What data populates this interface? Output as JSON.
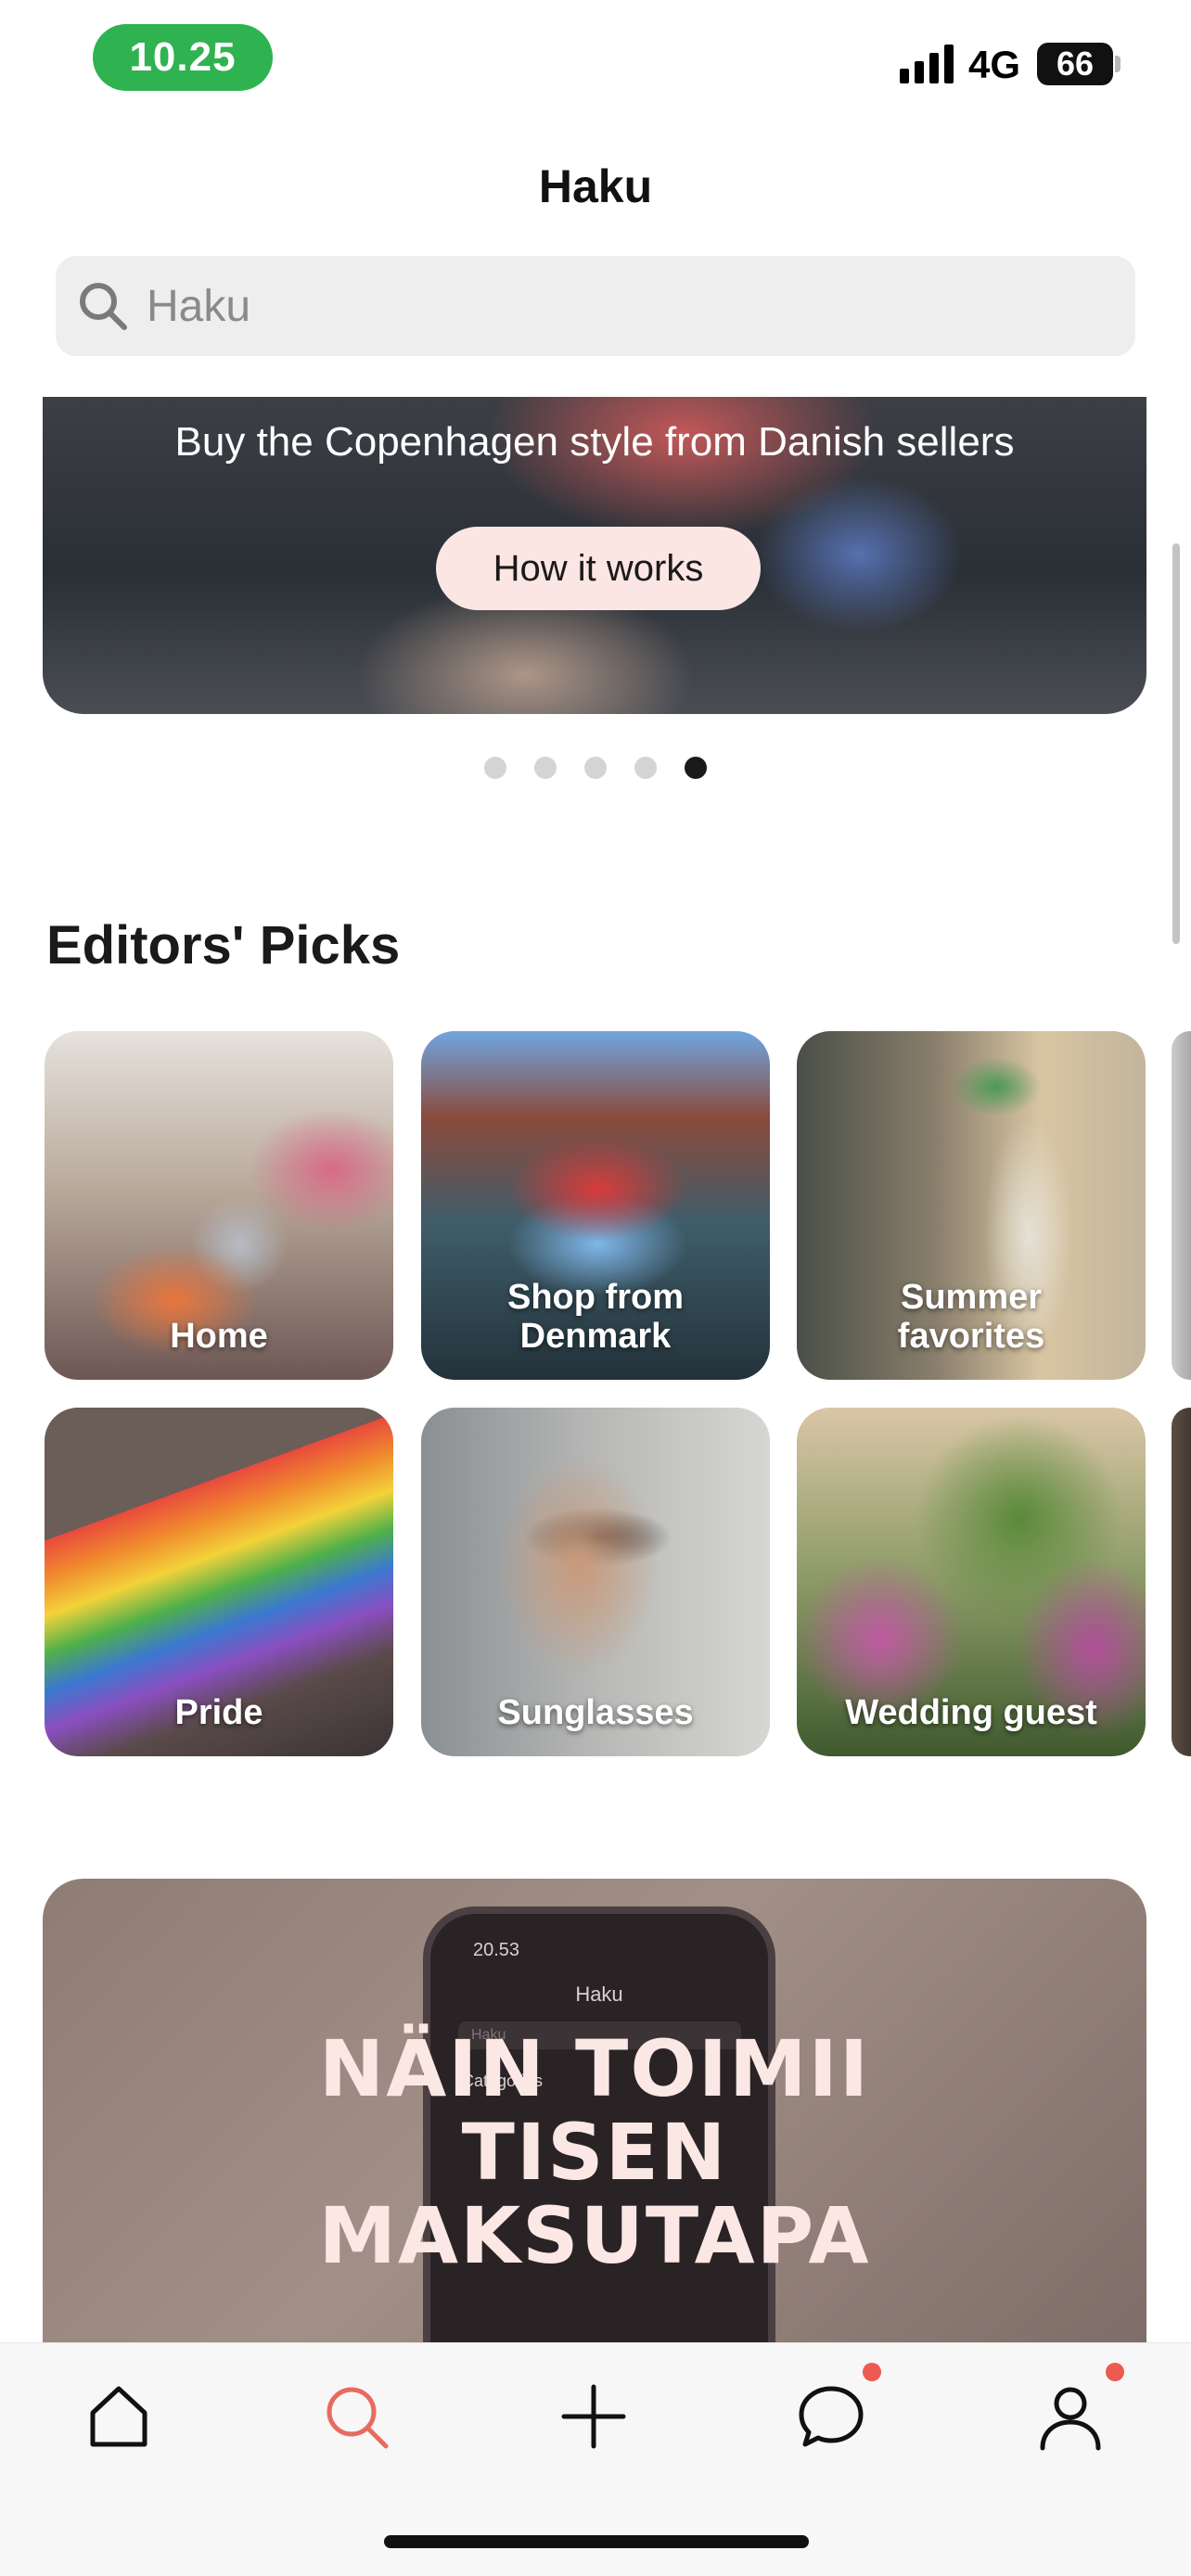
{
  "status_bar": {
    "time": "10.25",
    "network": "4G",
    "battery": "66",
    "time_pill_color": "#2fb350"
  },
  "header": {
    "title": "Haku",
    "search_placeholder": "Haku",
    "search_icon": "search-icon"
  },
  "hero": {
    "subtitle": "Buy the Copenhagen style from Danish sellers",
    "button_label": "How it works",
    "dots_total": 5,
    "active_dot": 5
  },
  "editors_picks": {
    "title": "Editors' Picks",
    "tiles": [
      {
        "label": "Home"
      },
      {
        "label": "Shop from Denmark"
      },
      {
        "label": "Summer favorites"
      },
      {
        "label": "Pride"
      },
      {
        "label": "Sunglasses"
      },
      {
        "label": "Wedding guest"
      }
    ]
  },
  "promo": {
    "lines": [
      "NÄIN TOIMII",
      "TISEN",
      "MAKSUTAPA"
    ],
    "phone_time": "20.53",
    "phone_title": "Haku",
    "phone_search": "Haku",
    "phone_section": "Categories"
  },
  "tab_bar": {
    "items": [
      {
        "icon": "home-icon",
        "active": false
      },
      {
        "icon": "search-icon",
        "active": true
      },
      {
        "icon": "plus-icon",
        "active": false
      },
      {
        "icon": "chat-bubble-icon",
        "active": false,
        "badge": true
      },
      {
        "icon": "profile-icon",
        "active": false,
        "badge": true
      }
    ],
    "accent_color": "#e96a5f",
    "badge_color": "#ec5b52"
  }
}
